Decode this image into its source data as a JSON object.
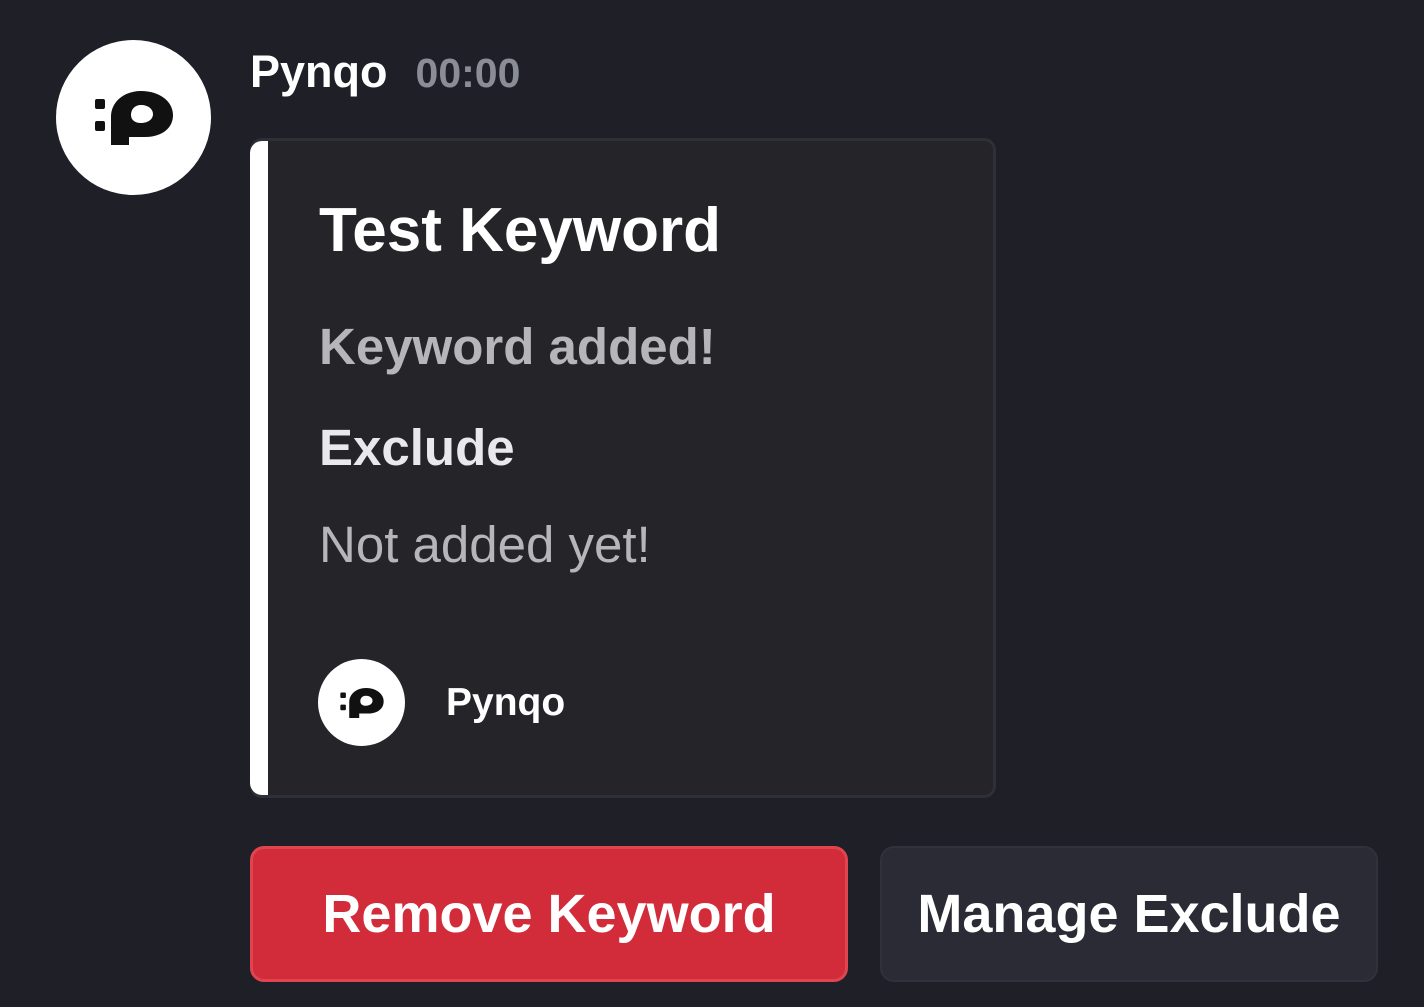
{
  "message": {
    "author": "Pynqo",
    "timestamp": "00:00",
    "avatar_icon": "pynqo-logo-icon"
  },
  "embed": {
    "accent_color": "#ffffff",
    "title": "Test Keyword",
    "description": "Keyword added!",
    "fields": [
      {
        "name": "Exclude",
        "value": "Not added yet!"
      }
    ],
    "footer": {
      "text": "Pynqo",
      "icon": "pynqo-logo-icon"
    }
  },
  "buttons": [
    {
      "label": "Remove Keyword",
      "style": "danger",
      "color": "#d22b3a"
    },
    {
      "label": "Manage Exclude",
      "style": "secondary",
      "color": "#2a2b35"
    }
  ]
}
